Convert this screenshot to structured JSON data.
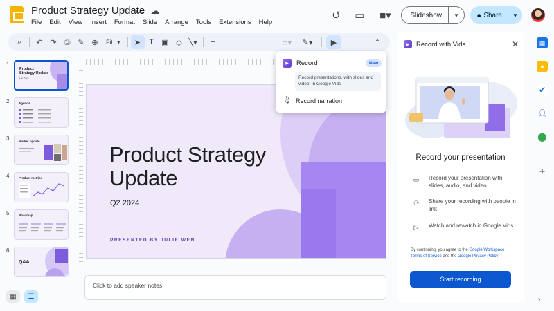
{
  "header": {
    "doc_title": "Product Strategy Update",
    "menus": [
      "File",
      "Edit",
      "View",
      "Insert",
      "Format",
      "Slide",
      "Arrange",
      "Tools",
      "Extensions",
      "Help"
    ],
    "slideshow_label": "Slideshow",
    "share_label": "Share"
  },
  "toolbar": {
    "zoom_label": "Fit"
  },
  "thumbnails": [
    {
      "num": "1",
      "title": "Product Strategy Update",
      "subtitle": "Q2 2024"
    },
    {
      "num": "2",
      "title": "Agenda"
    },
    {
      "num": "3",
      "title": "Market update"
    },
    {
      "num": "4",
      "title": "Product metrics"
    },
    {
      "num": "5",
      "title": "Roadmap"
    },
    {
      "num": "6",
      "title": "Q&A"
    }
  ],
  "slide": {
    "title": "Product Strategy Update",
    "subtitle": "Q2 2024",
    "presenter": "PRESENTED BY JULIE WEN"
  },
  "notes_placeholder": "Click to add speaker notes",
  "record_menu": {
    "record_label": "Record",
    "new_badge": "New",
    "record_desc": "Record presentations, with slides and video, in Google Vids",
    "narration_label": "Record narration"
  },
  "panel": {
    "title": "Record with Vids",
    "heading": "Record your presentation",
    "features": [
      {
        "icon": "monitor-icon",
        "text": "Record your presentation with slides, audio, and video"
      },
      {
        "icon": "share-person-icon",
        "text": "Share your recording with people in link"
      },
      {
        "icon": "play-icon",
        "text": "Watch and rewatch in Google Vids"
      }
    ],
    "disclaimer_prefix": "By continuing, you agree to the ",
    "disclaimer_link1": "Google Workspace Terms of Service",
    "disclaimer_mid": " and the ",
    "disclaimer_link2": "Google Privacy Policy",
    "start_label": "Start recording"
  },
  "colors": {
    "accent": "#0b57d0",
    "vids_purple": "#7c5cdb",
    "slide_bg": "#efe9f9"
  }
}
